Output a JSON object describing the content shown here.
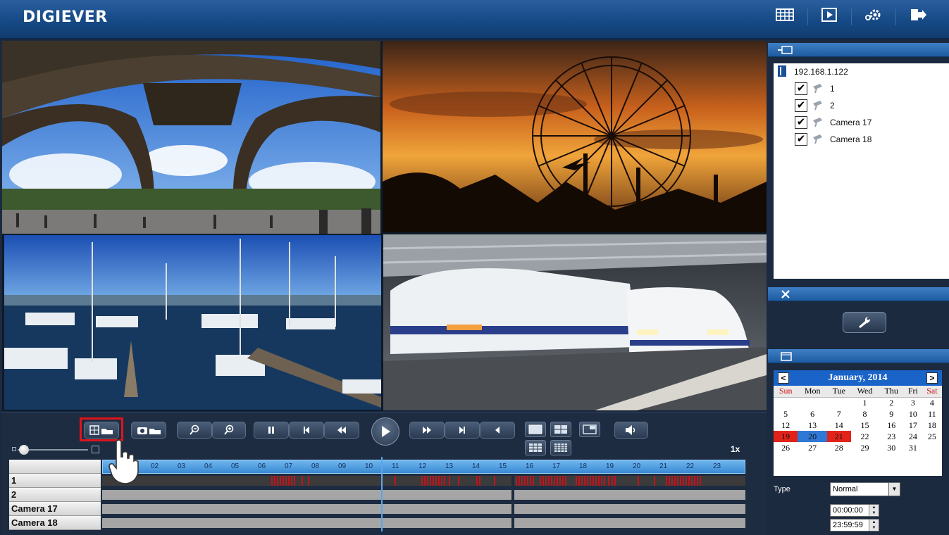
{
  "header": {
    "logo": "DIGIEVER",
    "icons": [
      "calendar-grid-icon",
      "playback-icon",
      "settings-gear-icon",
      "logout-icon"
    ]
  },
  "videos": [
    {
      "name": "eiffel-tower"
    },
    {
      "name": "ferris-wheel-sunset"
    },
    {
      "name": "marina-sailboats"
    },
    {
      "name": "bullet-trains"
    }
  ],
  "controls": {
    "speed": "1x"
  },
  "timeline": {
    "header_label": "",
    "hours": [
      "02",
      "03",
      "04",
      "05",
      "06",
      "07",
      "08",
      "09",
      "10",
      "11",
      "12",
      "13",
      "14",
      "15",
      "16",
      "17",
      "18",
      "19",
      "20",
      "21",
      "22",
      "23"
    ],
    "rows": [
      "1",
      "2",
      "Camera 17",
      "Camera 18"
    ]
  },
  "device_tree": {
    "host": "192.168.1.122",
    "cameras": [
      {
        "label": "1",
        "checked": true
      },
      {
        "label": "2",
        "checked": true
      },
      {
        "label": "Camera 17",
        "checked": true
      },
      {
        "label": "Camera 18",
        "checked": true
      }
    ]
  },
  "calendar": {
    "title": "January, 2014",
    "prev": "<",
    "next": ">",
    "weekdays": [
      "Sun",
      "Mon",
      "Tue",
      "Wed",
      "Thu",
      "Fri",
      "Sat"
    ],
    "weeks": [
      [
        "",
        "",
        "",
        "1",
        "2",
        "3",
        "4"
      ],
      [
        "5",
        "6",
        "7",
        "8",
        "9",
        "10",
        "11"
      ],
      [
        "12",
        "13",
        "14",
        "15",
        "16",
        "17",
        "18"
      ],
      [
        "19",
        "20",
        "21",
        "22",
        "23",
        "24",
        "25"
      ],
      [
        "26",
        "27",
        "28",
        "29",
        "30",
        "31",
        ""
      ]
    ],
    "highlight_red": [
      "19",
      "21"
    ],
    "highlight_blue": [
      "20"
    ]
  },
  "search": {
    "type_label": "Type",
    "type_value": "Normal",
    "start_time": "00:00:00",
    "end_time": "23:59:59"
  },
  "colors": {
    "header": "#164a86",
    "accent": "#1a63c8",
    "record": "#c0141c"
  }
}
